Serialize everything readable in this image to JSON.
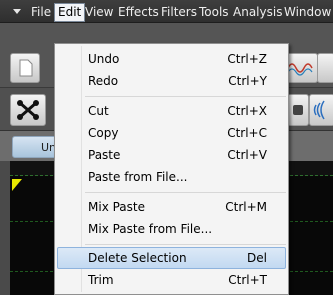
{
  "menubar": {
    "items": [
      {
        "label": "File"
      },
      {
        "label": "Edit"
      },
      {
        "label": "View"
      },
      {
        "label": "Effects"
      },
      {
        "label": "Filters"
      },
      {
        "label": "Tools"
      },
      {
        "label": "Analysis"
      },
      {
        "label": "Window"
      }
    ],
    "active": "Edit"
  },
  "tabs": [
    {
      "label": "Un"
    }
  ],
  "edit_menu": {
    "items": [
      {
        "label": "Undo",
        "shortcut": "Ctrl+Z"
      },
      {
        "label": "Redo",
        "shortcut": "Ctrl+Y"
      },
      {
        "label": "Cut",
        "shortcut": "Ctrl+X"
      },
      {
        "label": "Copy",
        "shortcut": "Ctrl+C"
      },
      {
        "label": "Paste",
        "shortcut": "Ctrl+V"
      },
      {
        "label": "Paste from File...",
        "shortcut": ""
      },
      {
        "label": "Mix Paste",
        "shortcut": "Ctrl+M"
      },
      {
        "label": "Mix Paste from File...",
        "shortcut": ""
      },
      {
        "label": "Delete Selection",
        "shortcut": "Del"
      },
      {
        "label": "Trim",
        "shortcut": "Ctrl+T"
      }
    ],
    "highlighted": "Delete Selection"
  },
  "colors": {
    "menubar_bg": "#333333",
    "menu_bg": "#f4f4f4",
    "highlight": "#c8dcf3",
    "waveform_bg": "#080808",
    "marker": "#e8e800"
  },
  "icons": [
    "menu-arrow-icon",
    "new-file-icon",
    "waveform-icon",
    "crossfade-icon",
    "hand-icon",
    "sound-wave-icon"
  ]
}
